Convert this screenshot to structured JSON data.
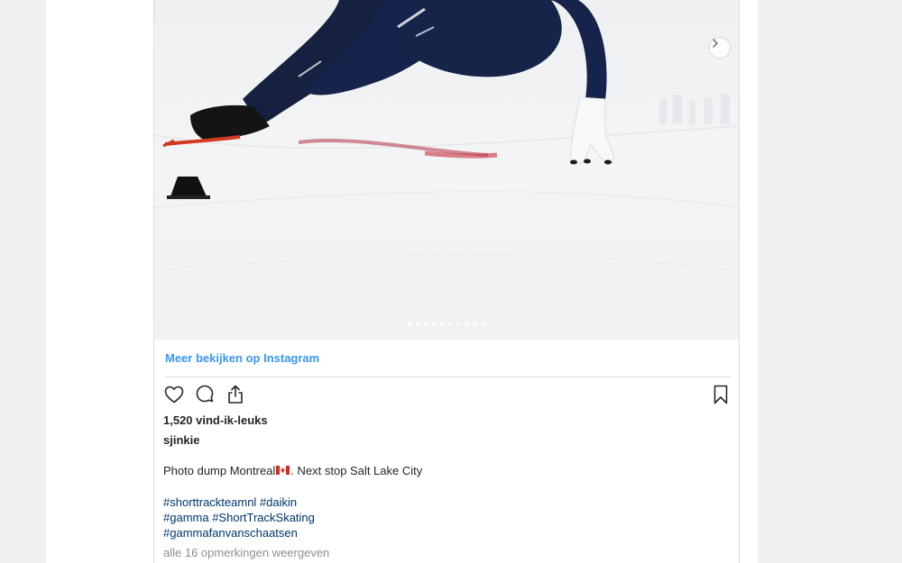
{
  "post": {
    "more_link": "Meer bekijken op Instagram",
    "likes": "1,520 vind-ik-leuks",
    "username": "sjinkie",
    "caption_before": "Photo dump Montreal",
    "caption_after": ". Next stop Salt Lake City",
    "hashtag_lines": [
      [
        "#shorttrackteamnl",
        "#daikin"
      ],
      [
        "#gamma",
        "#ShortTrackSkating"
      ],
      [
        "#gammafanvanschaatsen"
      ]
    ],
    "comments_link": "alle 16 opmerkingen weergeven"
  },
  "carousel": {
    "slide_count": 10,
    "active_slide": 1
  },
  "icons": {
    "like": "heart-icon",
    "comment": "comment-icon",
    "share": "share-icon",
    "save": "bookmark-icon",
    "next": "chevron-right-icon"
  },
  "colors": {
    "link": "#3897f0",
    "hashtag": "#003569",
    "muted": "#8e8e8e",
    "text": "#262626"
  }
}
